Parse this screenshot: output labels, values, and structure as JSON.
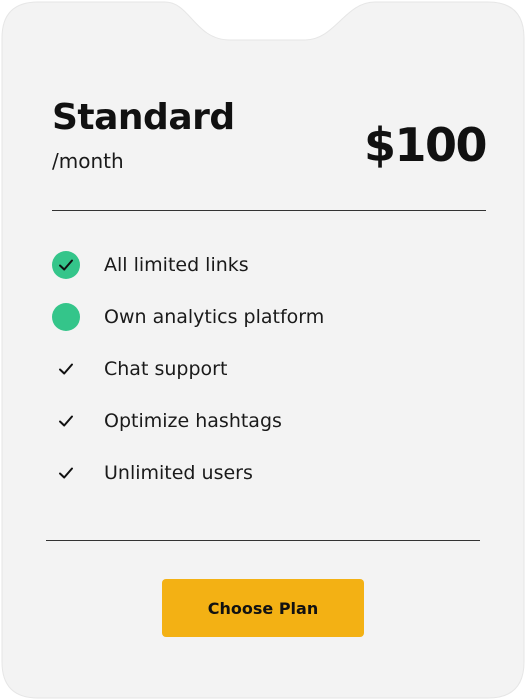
{
  "plan": {
    "name": "Standard",
    "period": "/month",
    "price": "$100"
  },
  "features": [
    {
      "label": "All limited links",
      "icon": "check-circle-icon"
    },
    {
      "label": "Own analytics platform",
      "icon": "filled-circle-icon"
    },
    {
      "label": "Chat support",
      "icon": "check-icon"
    },
    {
      "label": "Optimize hashtags",
      "icon": "check-icon"
    },
    {
      "label": "Unlimited users",
      "icon": "check-icon"
    }
  ],
  "cta": {
    "label": "Choose Plan"
  },
  "colors": {
    "card_background": "#f3f3f3",
    "accent_green": "#34c58a",
    "button_yellow": "#f3b114",
    "text": "#111111"
  }
}
